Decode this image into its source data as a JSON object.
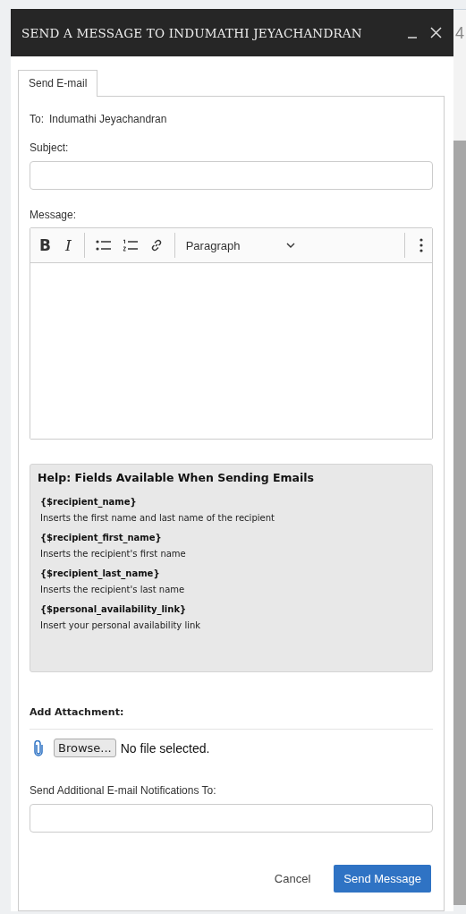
{
  "background_page": {
    "text": "4"
  },
  "window": {
    "title": "SEND A MESSAGE TO INDUMATHI JEYACHANDRAN"
  },
  "tabs": [
    {
      "label": "Send E-mail",
      "selected": true
    }
  ],
  "to": {
    "label": "To:",
    "value": "Indumathi Jeyachandran"
  },
  "subject": {
    "label": "Subject:"
  },
  "message": {
    "label": "Message:",
    "toolbar": [
      {
        "kind": "bold",
        "label": "B"
      },
      {
        "kind": "italic",
        "label": "I"
      },
      {
        "kind": "separator"
      },
      {
        "kind": "bullet_list"
      },
      {
        "kind": "numbered_list"
      },
      {
        "kind": "link"
      },
      {
        "kind": "separator"
      },
      {
        "kind": "format",
        "label": "Paragraph"
      },
      {
        "kind": "separator"
      },
      {
        "kind": "more"
      }
    ]
  },
  "help": {
    "title": "Help: Fields Available When Sending Emails",
    "items": [
      {
        "field": "{$recipient_name}",
        "description": "Inserts the first name and last name of the recipient"
      },
      {
        "field": "{$recipient_first_name}",
        "description": "Inserts the recipient's first name"
      },
      {
        "field": "{$recipient_last_name}",
        "description": "Inserts the recipient's last name"
      },
      {
        "field": "{$personal_availability_link}",
        "description": "Insert your personal availability link"
      }
    ]
  },
  "attachment": {
    "label": "Add Attachment:",
    "button": "Browse...",
    "status": "No file selected."
  },
  "notifications": {
    "label": "Send Additional E-mail Notifications To:"
  },
  "buttons": [
    {
      "kind": "link",
      "label": "Cancel"
    },
    {
      "kind": "primary",
      "label": "Send Message"
    }
  ]
}
